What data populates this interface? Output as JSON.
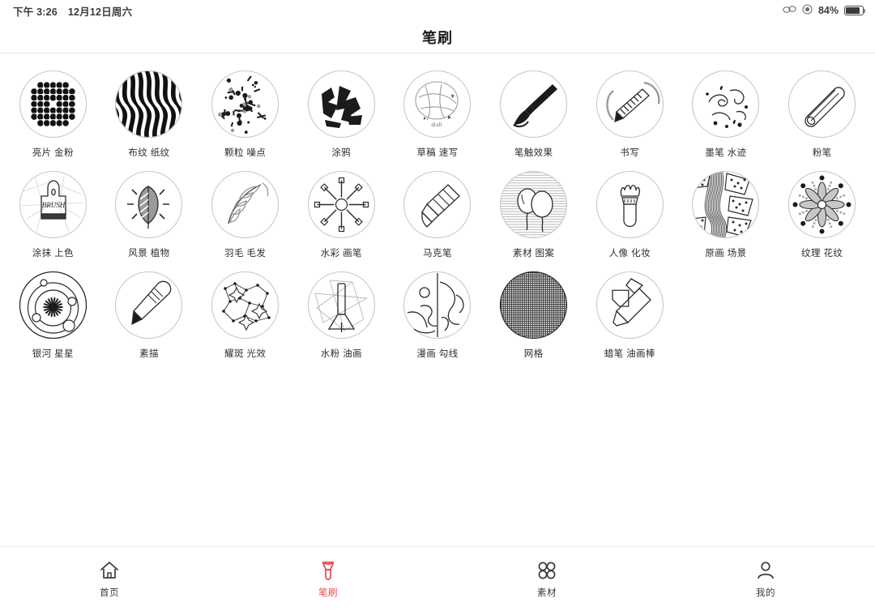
{
  "status_bar": {
    "time": "下午 3:26",
    "date": "12月12日周六",
    "battery_percent": "84%",
    "battery_level": 84,
    "icons": [
      "eye-glasses-icon",
      "moon-do-not-disturb-icon",
      "battery-icon"
    ]
  },
  "header": {
    "title": "笔刷"
  },
  "theme": {
    "accent": "#e8474b",
    "text": "#2e2e2e",
    "background": "#ffffff",
    "border": "#ececec"
  },
  "brushes": [
    {
      "label": "亮片 金粉",
      "icon": "glitter-dots-icon"
    },
    {
      "label": "布纹 纸纹",
      "icon": "fabric-grain-icon"
    },
    {
      "label": "颗粒 噪点",
      "icon": "particle-noise-icon"
    },
    {
      "label": "涂鸦",
      "icon": "graffiti-icon"
    },
    {
      "label": "草稿 速写",
      "icon": "sketch-draft-icon"
    },
    {
      "label": "笔触效果",
      "icon": "paintbrush-stroke-icon"
    },
    {
      "label": "书写",
      "icon": "writing-pencil-icon"
    },
    {
      "label": "墨笔 水迹",
      "icon": "ink-splatter-icon"
    },
    {
      "label": "粉笔",
      "icon": "chalk-stick-icon"
    },
    {
      "label": "涂抹 上色",
      "icon": "brush-stamp-icon"
    },
    {
      "label": "风景 植物",
      "icon": "leaf-plant-icon"
    },
    {
      "label": "羽毛 毛发",
      "icon": "feather-icon"
    },
    {
      "label": "水彩 画笔",
      "icon": "radial-brushes-icon"
    },
    {
      "label": "马克笔",
      "icon": "marker-pen-icon"
    },
    {
      "label": "素材 图案",
      "icon": "balloons-pattern-icon"
    },
    {
      "label": "人像 化妆",
      "icon": "makeup-brush-icon"
    },
    {
      "label": "原画 场景",
      "icon": "scenery-texture-icon"
    },
    {
      "label": "纹理 花纹",
      "icon": "floral-mandala-icon"
    },
    {
      "label": "银河 星星",
      "icon": "galaxy-orbit-icon"
    },
    {
      "label": "素描",
      "icon": "sketch-pencil-icon"
    },
    {
      "label": "耀斑 光效",
      "icon": "constellation-flare-icon"
    },
    {
      "label": "水粉 油画",
      "icon": "fan-brush-icon"
    },
    {
      "label": "漫画 勾线",
      "icon": "comic-lineart-icon"
    },
    {
      "label": "网格",
      "icon": "mesh-grid-icon"
    },
    {
      "label": "蜡笔 油画棒",
      "icon": "crossed-crayons-icon"
    }
  ],
  "tabbar": {
    "items": [
      {
        "label": "首页",
        "icon": "home-icon",
        "active": false
      },
      {
        "label": "笔刷",
        "icon": "brush-icon",
        "active": true
      },
      {
        "label": "素材",
        "icon": "grid-4-icon",
        "active": false
      },
      {
        "label": "我的",
        "icon": "person-icon",
        "active": false
      }
    ]
  }
}
